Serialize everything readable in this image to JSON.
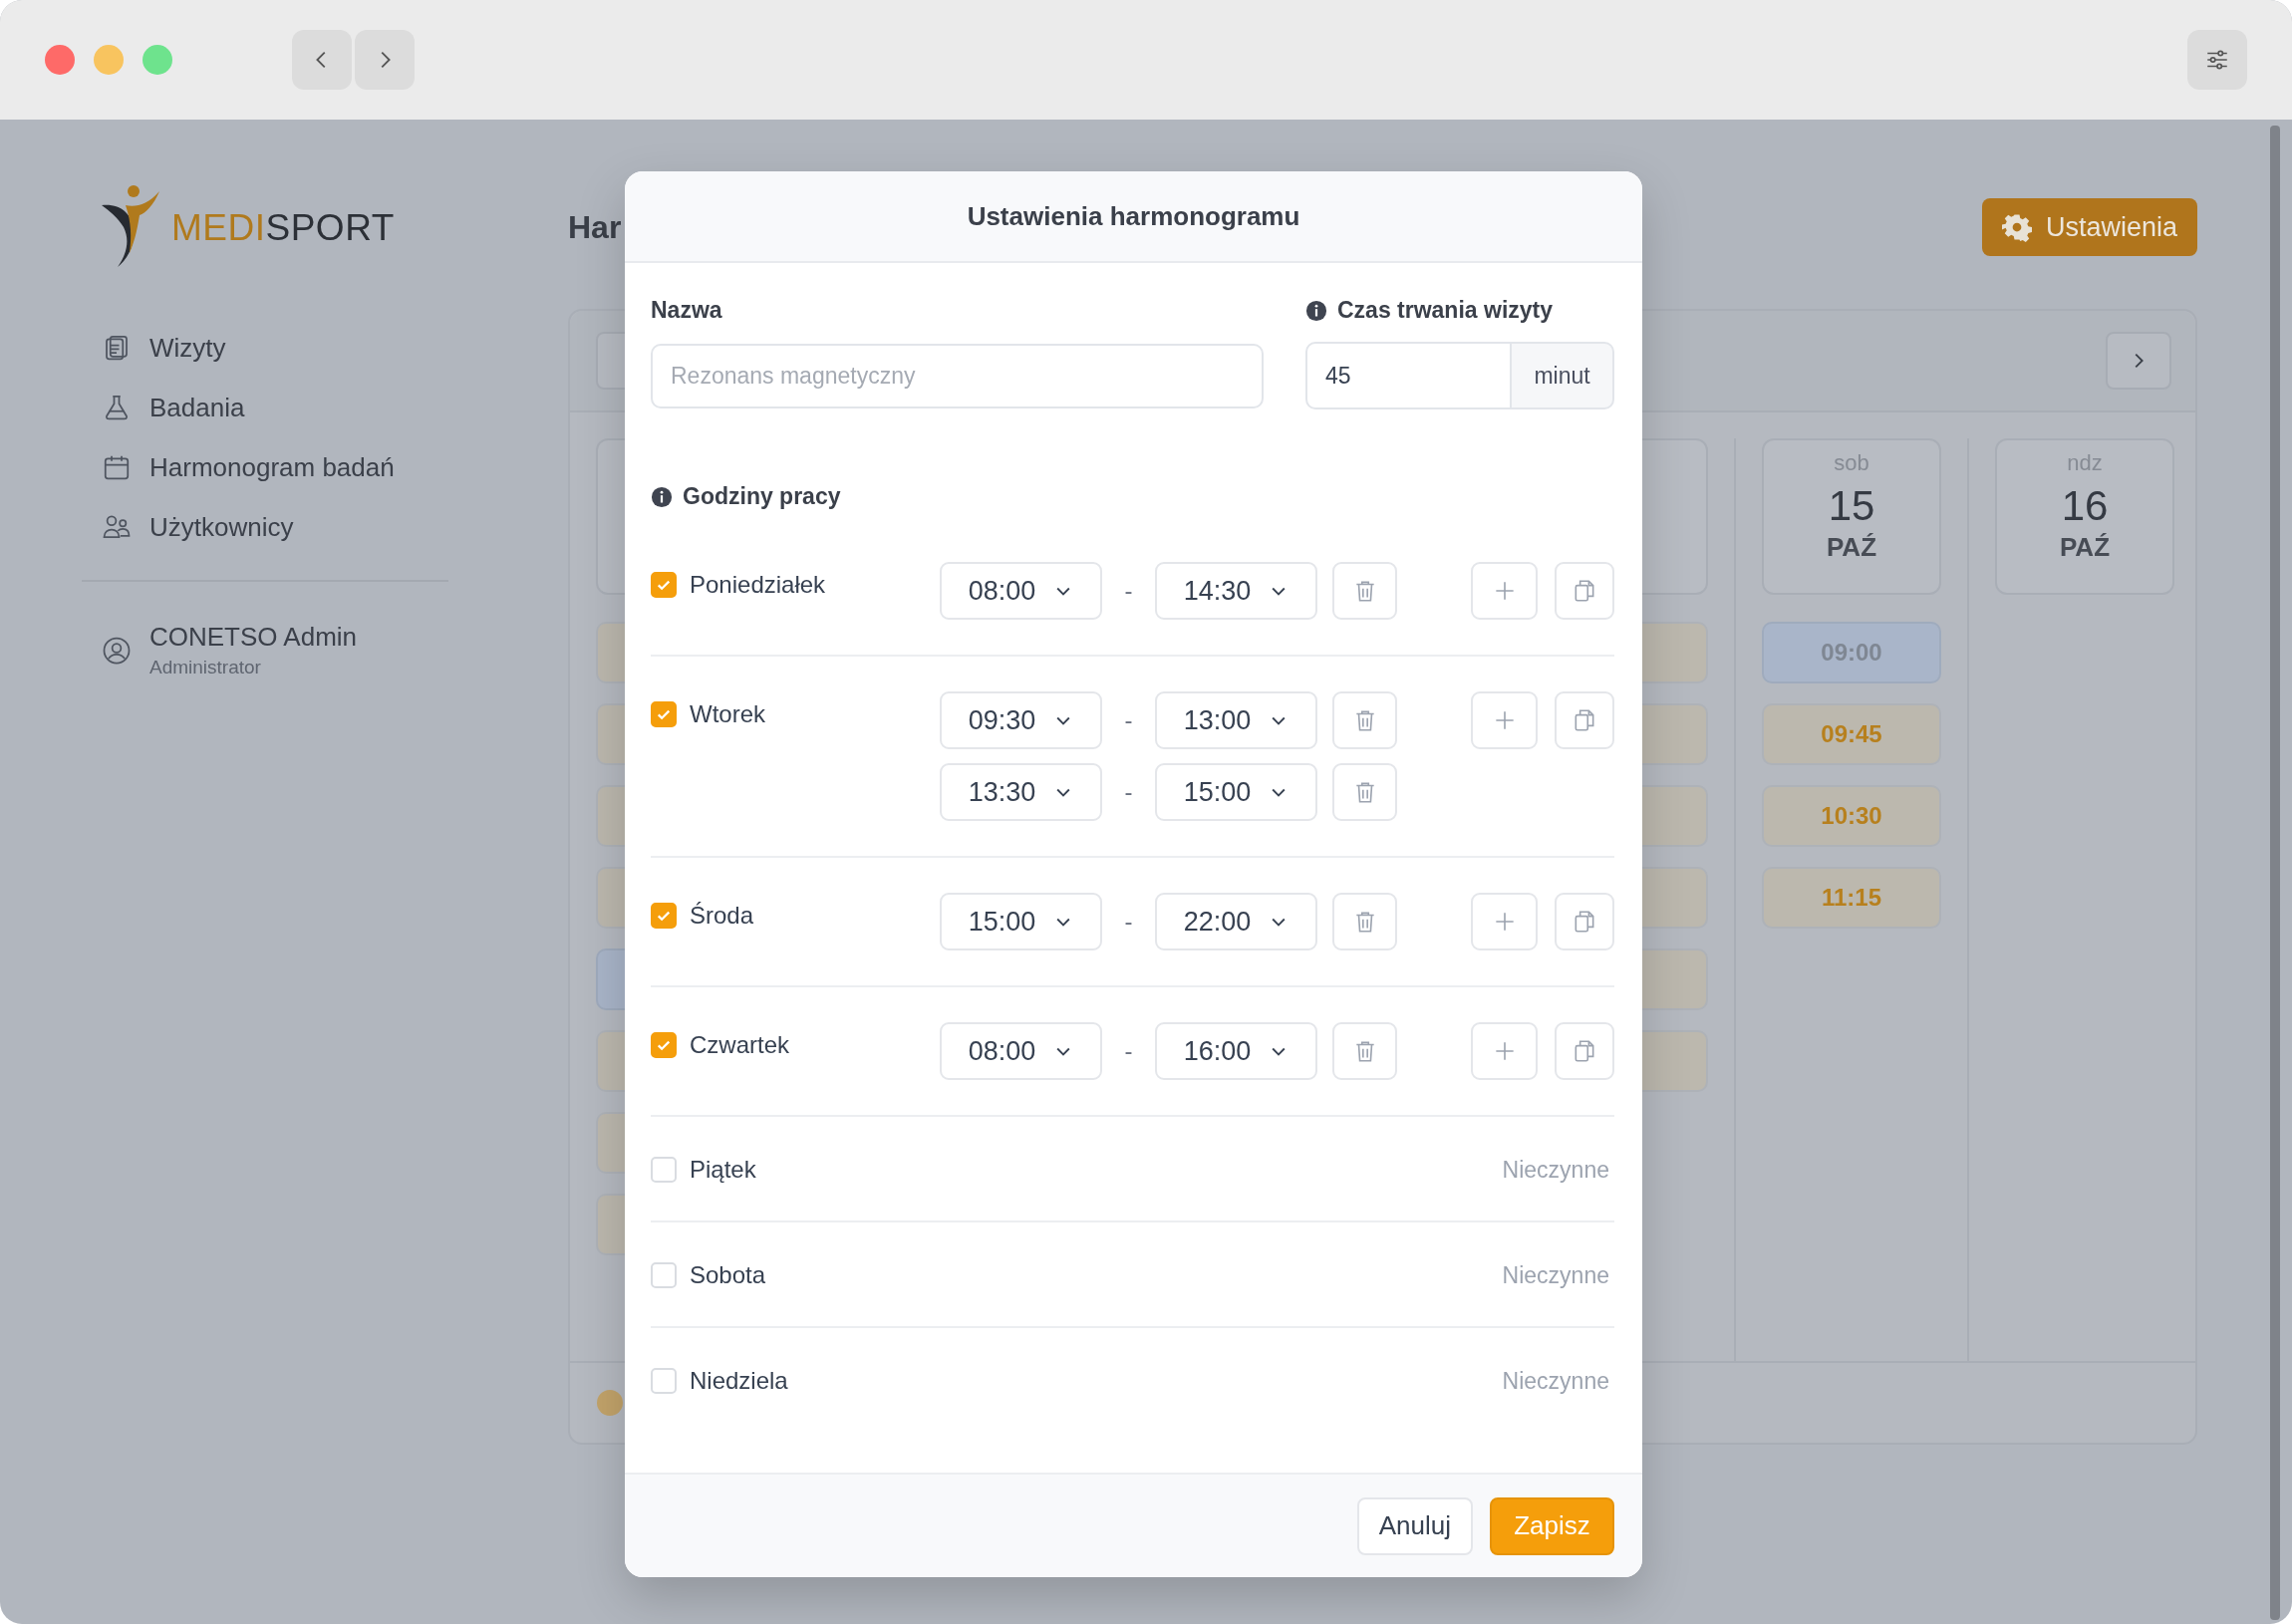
{
  "sidebar": {
    "logo": {
      "accent": "MEDI",
      "rest": "SPORT"
    },
    "menu": [
      {
        "label": "Wizyty",
        "kind": "visits"
      },
      {
        "label": "Badania",
        "kind": "tests"
      },
      {
        "label": "Harmonogram badań",
        "kind": "schedule"
      },
      {
        "label": "Użytkownicy",
        "kind": "users"
      }
    ],
    "user": {
      "name": "CONETSO Admin",
      "role": "Administrator"
    }
  },
  "page": {
    "title": "Har",
    "settings_button": "Ustawienia"
  },
  "calendar": {
    "days": [
      {
        "slots": [
          {
            "available": true
          },
          {
            "available": true
          },
          {
            "available": true
          },
          {
            "available": true
          },
          {
            "available": false
          },
          {
            "available": true
          },
          {
            "available": true
          },
          {
            "available": true
          }
        ]
      },
      {
        "slots": [
          {
            "available": true
          },
          {
            "available": true
          },
          {
            "available": true
          },
          {
            "available": true
          },
          {
            "available": true
          },
          {
            "available": true
          }
        ]
      },
      {
        "weekday": "sob",
        "day": "15",
        "month": "PAŹ",
        "slots": [
          {
            "time": "09:00",
            "available": false
          },
          {
            "time": "09:45",
            "available": true
          },
          {
            "time": "10:30",
            "available": true
          },
          {
            "time": "11:15",
            "available": true
          }
        ]
      },
      {
        "weekday": "ndz",
        "day": "16",
        "month": "PAŹ"
      }
    ]
  },
  "modal": {
    "title": "Ustawienia harmonogramu",
    "name_field": {
      "label": "Nazwa",
      "placeholder": "Rezonans magnetyczny"
    },
    "duration_field": {
      "label": "Czas trwania wizyty",
      "value": "45",
      "unit": "minut"
    },
    "hours_label": "Godziny pracy",
    "days": [
      {
        "label": "Poniedziałek",
        "checked": true,
        "intervals": [
          {
            "from": "08:00",
            "dash": "-",
            "to": "14:30"
          }
        ]
      },
      {
        "label": "Wtorek",
        "checked": true,
        "intervals": [
          {
            "from": "09:30",
            "dash": "-",
            "to": "13:00"
          },
          {
            "from": "13:30",
            "dash": "-",
            "to": "15:00"
          }
        ]
      },
      {
        "label": "Środa",
        "checked": true,
        "intervals": [
          {
            "from": "15:00",
            "dash": "-",
            "to": "22:00"
          }
        ]
      },
      {
        "label": "Czwartek",
        "checked": true,
        "intervals": [
          {
            "from": "08:00",
            "dash": "-",
            "to": "16:00"
          }
        ]
      },
      {
        "label": "Piątek",
        "checked": false,
        "closed_text": "Nieczynne"
      },
      {
        "label": "Sobota",
        "checked": false,
        "closed_text": "Nieczynne"
      },
      {
        "label": "Niedziela",
        "checked": false,
        "closed_text": "Nieczynne"
      }
    ],
    "buttons": [
      {
        "label": "Anuluj",
        "kind": "secondary"
      },
      {
        "label": "Zapisz",
        "kind": "primary"
      }
    ]
  }
}
